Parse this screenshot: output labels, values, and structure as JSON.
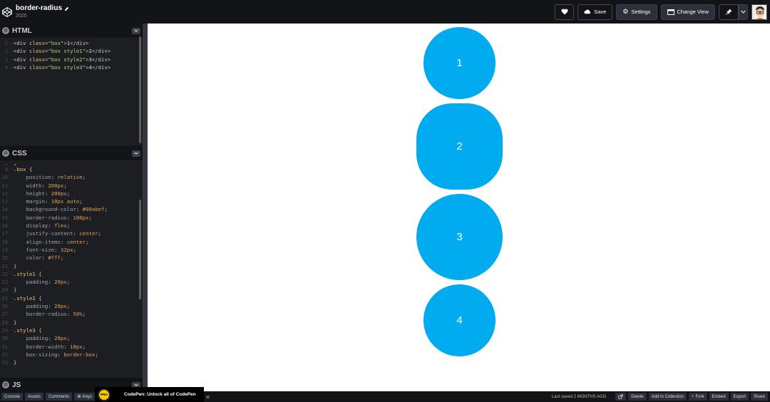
{
  "header": {
    "pen_title": "border-radius",
    "pen_subtitle": "2020",
    "buttons": {
      "save": "Save",
      "settings": "Settings",
      "change_view": "Change View"
    }
  },
  "editors": {
    "html": {
      "label": "HTML"
    },
    "css": {
      "label": "CSS"
    },
    "js": {
      "label": "JS"
    }
  },
  "preview": {
    "accent_color": "#00abef",
    "boxes": [
      "1",
      "2",
      "3",
      "4"
    ]
  },
  "footer": {
    "left_buttons": [
      "Console",
      "Assets",
      "Comments",
      "⌘ Keys"
    ],
    "promo_badge": "PRO",
    "promo_text": "CodePen: Unlock all of CodePen",
    "saved_status": "Last saved 2 MONTHS AGO",
    "right_buttons": [
      "Delete",
      "Add to Collection",
      "Fork",
      "Embed",
      "Export",
      "Share"
    ]
  }
}
